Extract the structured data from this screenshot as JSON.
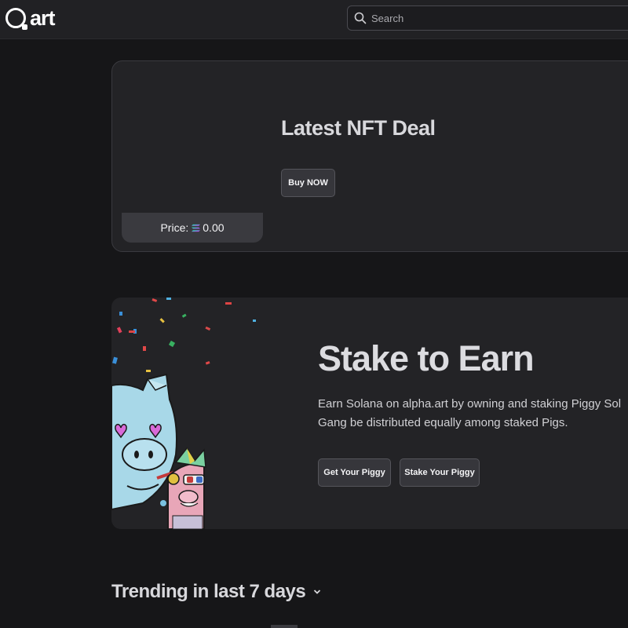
{
  "header": {
    "logo_text": "art",
    "search_placeholder": "Search"
  },
  "deal": {
    "title": "Latest NFT Deal",
    "buy_label": "Buy NOW",
    "price_label": "Price:",
    "price_value": "0.00"
  },
  "stake": {
    "title": "Stake to Earn",
    "description": "Earn Solana on alpha.art by owning and staking Piggy Sol Gang be distributed equally among staked Pigs.",
    "get_label": "Get Your Piggy",
    "stake_label": "Stake Your Piggy"
  },
  "trending": {
    "title": "Trending in last 7 days"
  },
  "colors": {
    "background": "#161618",
    "card": "#232326",
    "button": "#36363b",
    "pig_blue": "#a8d8e8",
    "pig_pink": "#e8a6b8"
  }
}
